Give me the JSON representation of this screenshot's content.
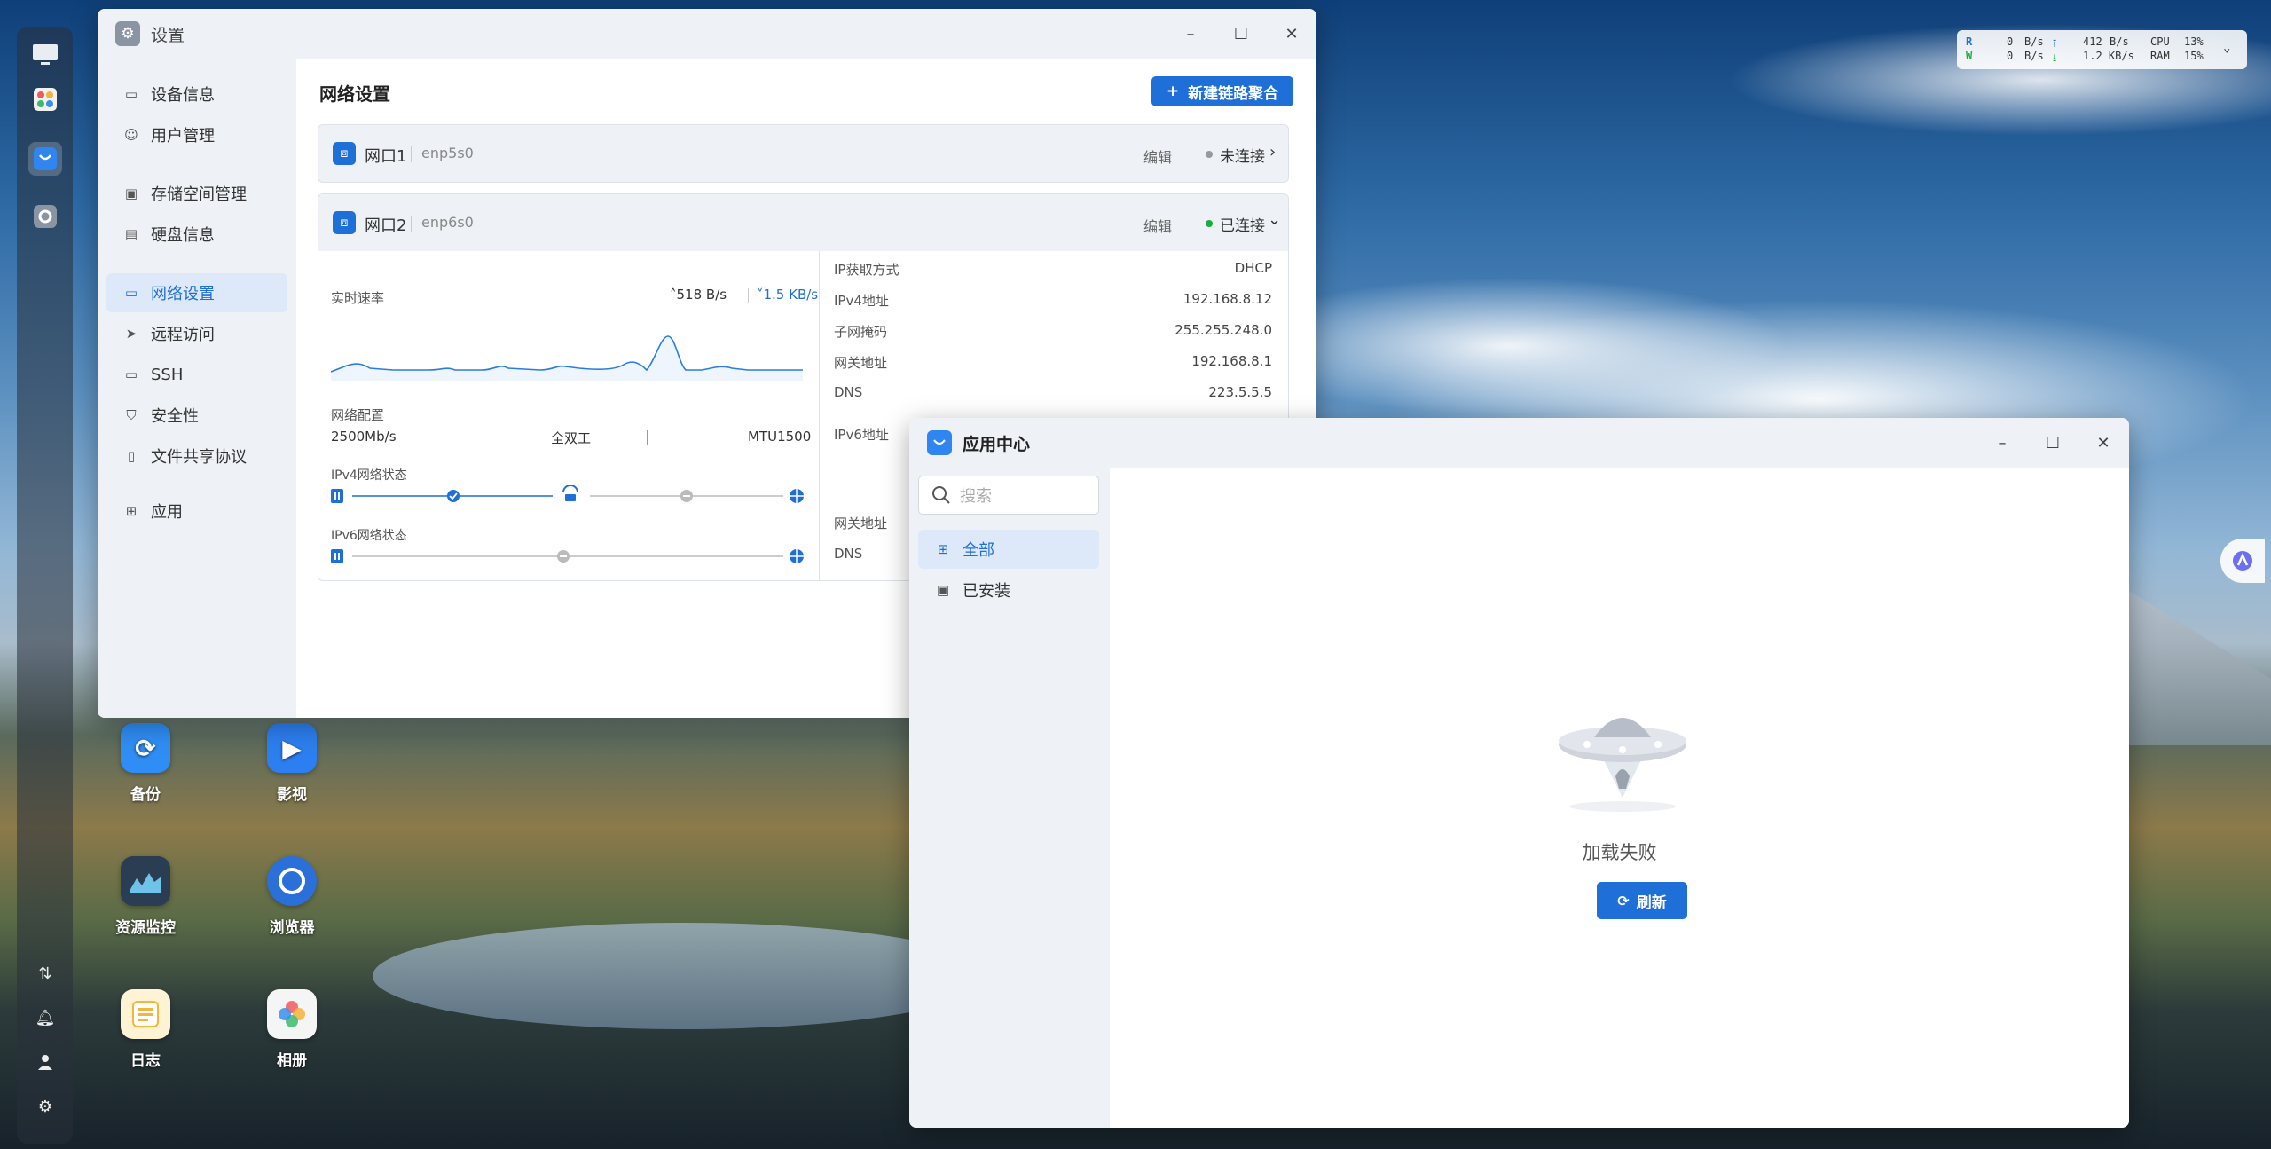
{
  "monitor": {
    "r_label": "R",
    "w_label": "W",
    "r_speed": "0",
    "r_unit": "B/s",
    "w_speed": "0",
    "w_unit": "B/s",
    "up_speed": "412",
    "up_unit": "B/s",
    "down_speed": "1.2 KB/s",
    "cpu_label": "CPU",
    "cpu_value": "13%",
    "ram_label": "RAM",
    "ram_value": "15%"
  },
  "desktop_icons": [
    {
      "label": "备份"
    },
    {
      "label": "影视"
    },
    {
      "label": "资源监控"
    },
    {
      "label": "浏览器"
    },
    {
      "label": "日志"
    },
    {
      "label": "相册"
    }
  ],
  "settings": {
    "title": "设置",
    "sidebar": [
      {
        "label": "设备信息"
      },
      {
        "label": "用户管理"
      },
      {
        "label": "存储空间管理"
      },
      {
        "label": "硬盘信息"
      },
      {
        "label": "网络设置"
      },
      {
        "label": "远程访问"
      },
      {
        "label": "SSH"
      },
      {
        "label": "安全性"
      },
      {
        "label": "文件共享协议"
      },
      {
        "label": "应用"
      }
    ],
    "page_title": "网络设置",
    "new_agg_button": "新建链路聚合",
    "ports": [
      {
        "name": "网口1",
        "iface": "enp5s0",
        "edit": "编辑",
        "status": "未连接",
        "status_color": "#999999"
      },
      {
        "name": "网口2",
        "iface": "enp6s0",
        "edit": "编辑",
        "status": "已连接",
        "status_color": "#1aad3e"
      }
    ],
    "realtime_label": "实时速率",
    "up_rate": "518 B/s",
    "down_rate": "1.5 KB/s",
    "net_config_label": "网络配置",
    "speed": "2500Mb/s",
    "duplex": "全双工",
    "mtu": "MTU1500",
    "ipv4_status_label": "IPv4网络状态",
    "ipv6_status_label": "IPv6网络状态",
    "ipv4_info": [
      {
        "label": "IP获取方式",
        "value": "DHCP"
      },
      {
        "label": "IPv4地址",
        "value": "192.168.8.12"
      },
      {
        "label": "子网掩码",
        "value": "255.255.248.0"
      },
      {
        "label": "网关地址",
        "value": "192.168.8.1"
      },
      {
        "label": "DNS",
        "value": "223.5.5.5"
      }
    ],
    "ipv6_addr_label": "IPv6地址",
    "ipv6_gateway_label": "网关地址",
    "ipv6_dns_label": "DNS"
  },
  "appcenter": {
    "title": "应用中心",
    "search_placeholder": "搜索",
    "nav": [
      {
        "label": "全部"
      },
      {
        "label": "已安装"
      }
    ],
    "empty_text": "加载失败",
    "refresh_button": "刷新"
  },
  "colors": {
    "accent": "#1f6fd9",
    "titlebar": "#eef1f6"
  }
}
